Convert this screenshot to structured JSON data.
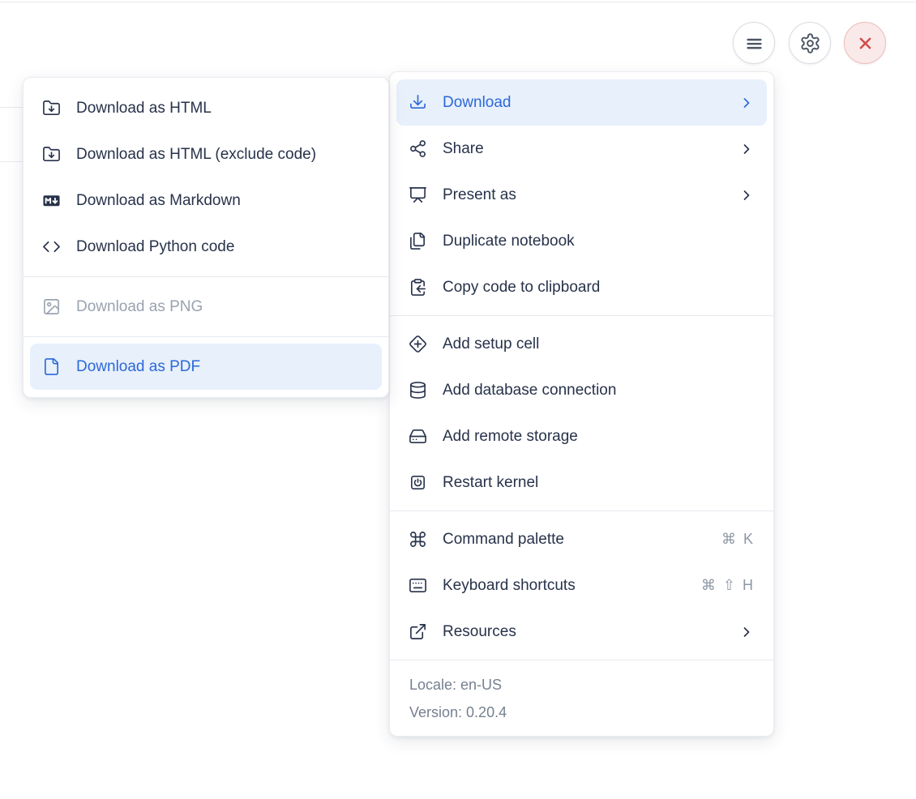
{
  "colors": {
    "accent_blue": "#2c68d9",
    "highlight_bg": "#e7f0fb",
    "text": "#27324a",
    "muted_text": "#76808f",
    "disabled_text": "#9aa3b0",
    "danger_red": "#d24a4a",
    "danger_bg": "#fae9e9",
    "separator": "#e5e9ef"
  },
  "toolbar": {
    "buttons": [
      {
        "name": "notebook-menu-button",
        "icon": "hamburger-menu-icon",
        "variant": "default"
      },
      {
        "name": "settings-button",
        "icon": "gear-icon",
        "variant": "default"
      },
      {
        "name": "shutdown-button",
        "icon": "close-icon",
        "variant": "danger"
      }
    ]
  },
  "download_submenu": {
    "items": [
      {
        "label": "Download as HTML",
        "icon": "folder-download-icon"
      },
      {
        "label": "Download as HTML (exclude code)",
        "icon": "folder-download-icon"
      },
      {
        "label": "Download as Markdown",
        "icon": "markdown-download-icon"
      },
      {
        "label": "Download Python code",
        "icon": "code-icon"
      },
      {
        "separator": true
      },
      {
        "label": "Download as PNG",
        "icon": "image-icon",
        "disabled": true
      },
      {
        "separator": true
      },
      {
        "label": "Download as PDF",
        "icon": "file-icon",
        "highlighted": true
      }
    ]
  },
  "main_menu": {
    "items": [
      {
        "label": "Download",
        "icon": "download-icon",
        "submenu": true,
        "highlighted": true
      },
      {
        "label": "Share",
        "icon": "share-icon",
        "submenu": true
      },
      {
        "label": "Present as",
        "icon": "presentation-icon",
        "submenu": true
      },
      {
        "label": "Duplicate notebook",
        "icon": "duplicate-icon"
      },
      {
        "label": "Copy code to clipboard",
        "icon": "clipboard-copy-icon"
      },
      {
        "separator": true
      },
      {
        "label": "Add setup cell",
        "icon": "diamond-plus-icon"
      },
      {
        "label": "Add database connection",
        "icon": "database-icon"
      },
      {
        "label": "Add remote storage",
        "icon": "hard-drive-icon"
      },
      {
        "label": "Restart kernel",
        "icon": "power-square-icon"
      },
      {
        "separator": true
      },
      {
        "label": "Command palette",
        "icon": "command-icon",
        "shortcut": [
          "⌘",
          "K"
        ]
      },
      {
        "label": "Keyboard shortcuts",
        "icon": "keyboard-icon",
        "shortcut": [
          "⌘",
          "⇧",
          "H"
        ]
      },
      {
        "label": "Resources",
        "icon": "external-link-icon",
        "submenu": true
      },
      {
        "separator": true
      }
    ],
    "footer": {
      "locale": "Locale: en-US",
      "version": "Version: 0.20.4"
    }
  }
}
